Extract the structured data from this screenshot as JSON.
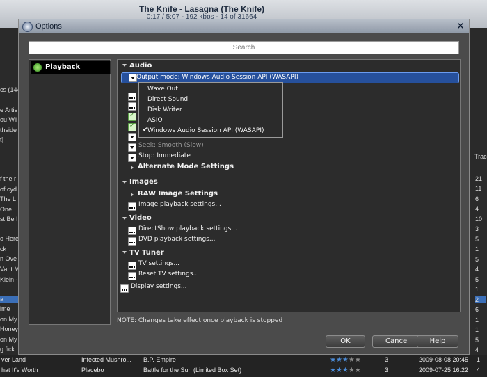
{
  "background": {
    "now_playing_title": "The Knife - Lasagna (The Knife)",
    "now_playing_info": "0:17 / 5:07 - 192 kbps - 14 of 31664",
    "left_fragments": [
      "cs (144",
      "e Artis",
      "ou Wil",
      "thside",
      "t]",
      "f the r",
      "of cyd",
      "The L",
      "One",
      "st Be I",
      "o Here",
      "ck",
      "n Ove",
      "Vant M",
      "Klein -",
      "a",
      "ime",
      "on My",
      "Honey",
      "on My",
      "g fick"
    ],
    "right_header": "Trac",
    "right_numbers": [
      "21",
      "11",
      "6",
      "4",
      "10",
      "3",
      "5",
      "1",
      "5",
      "4",
      "5",
      "1",
      "2",
      "6",
      "1",
      "1",
      "5",
      "4"
    ],
    "rows": [
      {
        "col1": "ver Land",
        "col2": "Infected Mushro...",
        "col3": "B.P. Empire",
        "rating": 3,
        "track": "3",
        "date": "2009-08-08 20:45",
        "num": "1"
      },
      {
        "col1": "hat It's Worth",
        "col2": "Placebo",
        "col3": "Battle for the Sun (Limited Box Set)",
        "rating": 3,
        "track": "3",
        "date": "2009-07-25 16:22",
        "num": "4"
      }
    ]
  },
  "dialog": {
    "title": "Options",
    "close_glyph": "✕",
    "search_placeholder": "Search",
    "sidebar": {
      "items": [
        {
          "label": "Playback",
          "selected": true
        }
      ]
    },
    "sections": {
      "audio": {
        "title": "Audio",
        "output_mode": "Output mode: Windows Audio Session API (WASAPI)",
        "dropdown_options": [
          "Wave Out",
          "Direct Sound",
          "Disk Writer",
          "ASIO",
          "Windows Audio Session API (WASAPI)"
        ],
        "dropdown_selected_index": 4,
        "seek_partial": "Seek: Smooth (Slow)",
        "stop": "Stop: Immediate",
        "alternate_mode": "Alternate Mode Settings"
      },
      "images": {
        "title": "Images",
        "raw": "RAW Image Settings",
        "playback": "Image playback settings..."
      },
      "video": {
        "title": "Video",
        "directshow": "DirectShow playback settings...",
        "dvd": "DVD playback settings..."
      },
      "tv_tuner": {
        "title": "TV Tuner",
        "tv_settings": "TV settings...",
        "reset_tv": "Reset TV settings..."
      },
      "display_settings": "Display settings..."
    },
    "note": "NOTE: Changes take effect once playback is stopped",
    "buttons": {
      "ok": "OK",
      "cancel": "Cancel",
      "help": "Help"
    }
  }
}
